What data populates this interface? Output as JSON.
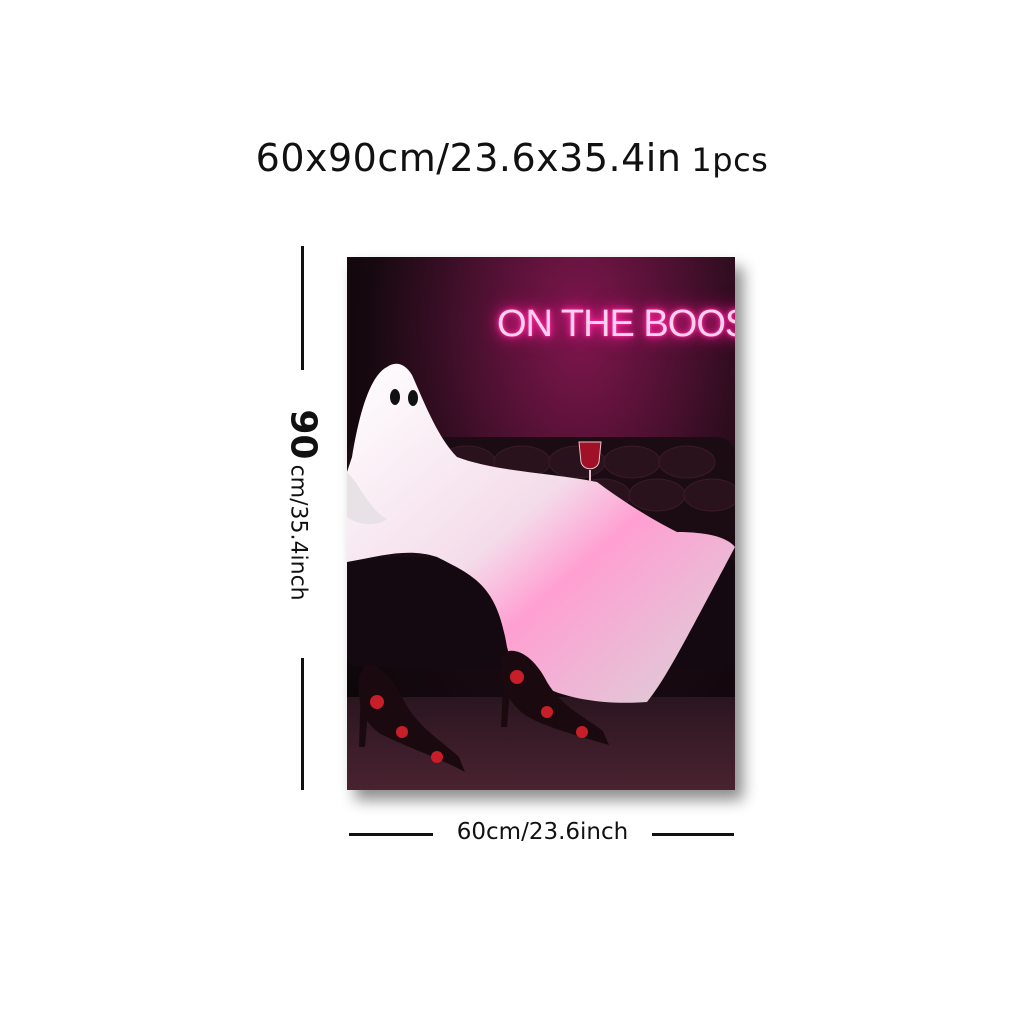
{
  "product": {
    "headline": "60x90cm/23.6x35.4in",
    "quantity": "1pcs"
  },
  "dimensions": {
    "height_value": "90",
    "height_label": "cm/35.4inch",
    "width_label": "60cm/23.6inch"
  },
  "poster": {
    "neon_text": "ON THE BOOS",
    "neon_color": "#ff2aa0"
  }
}
